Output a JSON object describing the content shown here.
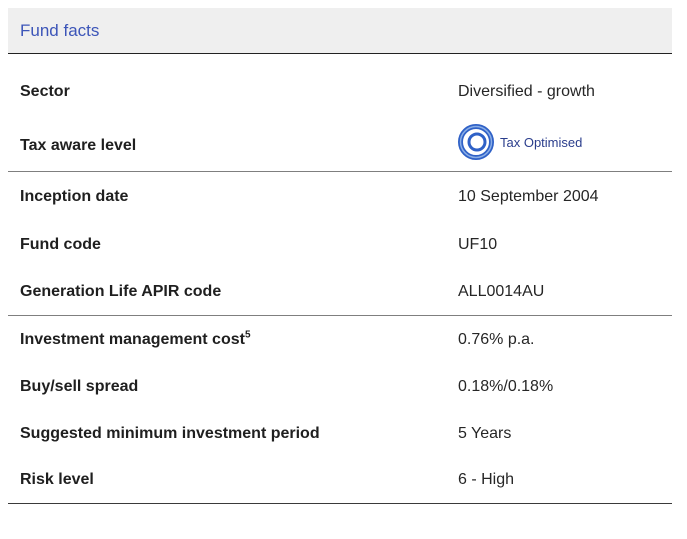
{
  "header": {
    "title": "Fund facts"
  },
  "colors": {
    "header_background": "#efefef",
    "header_text": "#3c55b8",
    "badge_ring": "#2f61c7",
    "badge_text": "#2a3d8c"
  },
  "groups": [
    {
      "rows": [
        {
          "label": "Sector",
          "value": "Diversified - growth"
        },
        {
          "label": "Tax aware level",
          "value": "Tax Optimised",
          "icon": "tax-optimised-ring-icon"
        }
      ]
    },
    {
      "rows": [
        {
          "label": "Inception date",
          "value": "10 September 2004"
        },
        {
          "label": "Fund code",
          "value": "UF10"
        },
        {
          "label": "Generation Life APIR code",
          "value": "ALL0014AU"
        }
      ]
    },
    {
      "rows": [
        {
          "label": "Investment management cost",
          "footnote": "5",
          "value": "0.76% p.a."
        },
        {
          "label": "Buy/sell spread",
          "value": "0.18%/0.18%"
        },
        {
          "label": "Suggested minimum investment period",
          "value": "5 Years"
        },
        {
          "label": "Risk level",
          "value": "6 - High"
        }
      ]
    }
  ]
}
